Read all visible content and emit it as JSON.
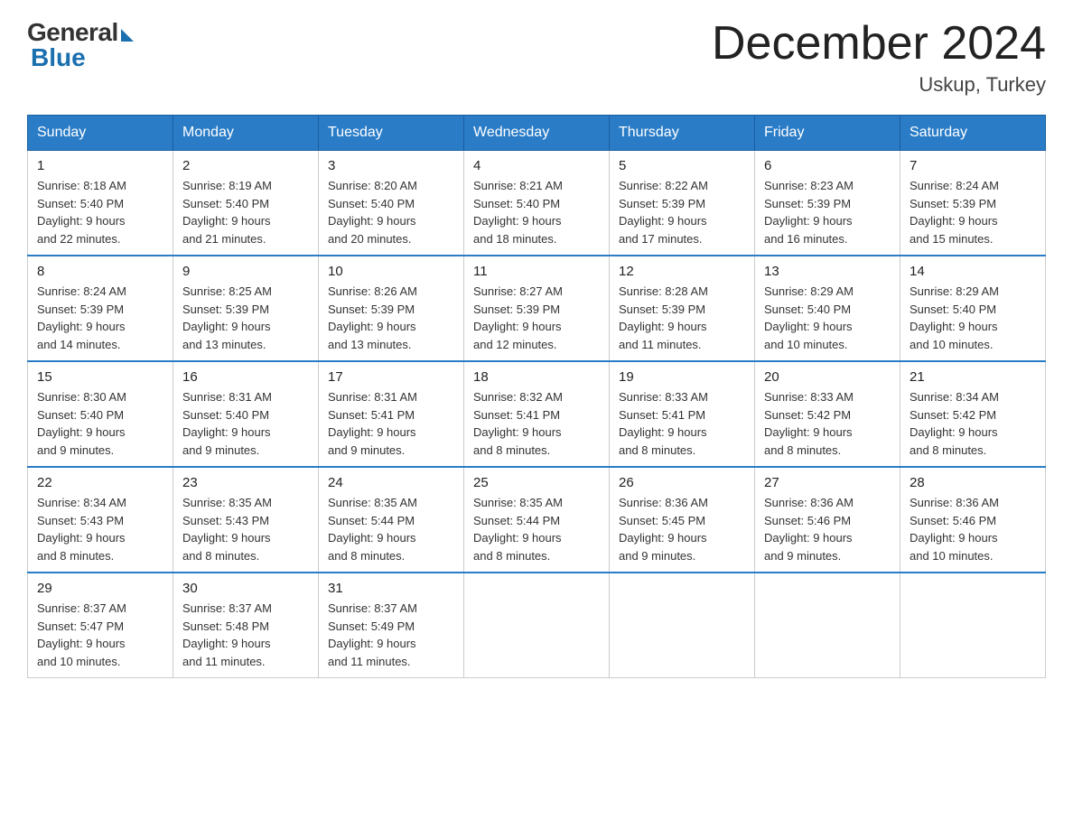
{
  "header": {
    "logo_general": "General",
    "logo_blue": "Blue",
    "month_year": "December 2024",
    "location": "Uskup, Turkey"
  },
  "days_of_week": [
    "Sunday",
    "Monday",
    "Tuesday",
    "Wednesday",
    "Thursday",
    "Friday",
    "Saturday"
  ],
  "weeks": [
    [
      {
        "day": "1",
        "sunrise": "8:18 AM",
        "sunset": "5:40 PM",
        "daylight": "9 hours and 22 minutes."
      },
      {
        "day": "2",
        "sunrise": "8:19 AM",
        "sunset": "5:40 PM",
        "daylight": "9 hours and 21 minutes."
      },
      {
        "day": "3",
        "sunrise": "8:20 AM",
        "sunset": "5:40 PM",
        "daylight": "9 hours and 20 minutes."
      },
      {
        "day": "4",
        "sunrise": "8:21 AM",
        "sunset": "5:40 PM",
        "daylight": "9 hours and 18 minutes."
      },
      {
        "day": "5",
        "sunrise": "8:22 AM",
        "sunset": "5:39 PM",
        "daylight": "9 hours and 17 minutes."
      },
      {
        "day": "6",
        "sunrise": "8:23 AM",
        "sunset": "5:39 PM",
        "daylight": "9 hours and 16 minutes."
      },
      {
        "day": "7",
        "sunrise": "8:24 AM",
        "sunset": "5:39 PM",
        "daylight": "9 hours and 15 minutes."
      }
    ],
    [
      {
        "day": "8",
        "sunrise": "8:24 AM",
        "sunset": "5:39 PM",
        "daylight": "9 hours and 14 minutes."
      },
      {
        "day": "9",
        "sunrise": "8:25 AM",
        "sunset": "5:39 PM",
        "daylight": "9 hours and 13 minutes."
      },
      {
        "day": "10",
        "sunrise": "8:26 AM",
        "sunset": "5:39 PM",
        "daylight": "9 hours and 13 minutes."
      },
      {
        "day": "11",
        "sunrise": "8:27 AM",
        "sunset": "5:39 PM",
        "daylight": "9 hours and 12 minutes."
      },
      {
        "day": "12",
        "sunrise": "8:28 AM",
        "sunset": "5:39 PM",
        "daylight": "9 hours and 11 minutes."
      },
      {
        "day": "13",
        "sunrise": "8:29 AM",
        "sunset": "5:40 PM",
        "daylight": "9 hours and 10 minutes."
      },
      {
        "day": "14",
        "sunrise": "8:29 AM",
        "sunset": "5:40 PM",
        "daylight": "9 hours and 10 minutes."
      }
    ],
    [
      {
        "day": "15",
        "sunrise": "8:30 AM",
        "sunset": "5:40 PM",
        "daylight": "9 hours and 9 minutes."
      },
      {
        "day": "16",
        "sunrise": "8:31 AM",
        "sunset": "5:40 PM",
        "daylight": "9 hours and 9 minutes."
      },
      {
        "day": "17",
        "sunrise": "8:31 AM",
        "sunset": "5:41 PM",
        "daylight": "9 hours and 9 minutes."
      },
      {
        "day": "18",
        "sunrise": "8:32 AM",
        "sunset": "5:41 PM",
        "daylight": "9 hours and 8 minutes."
      },
      {
        "day": "19",
        "sunrise": "8:33 AM",
        "sunset": "5:41 PM",
        "daylight": "9 hours and 8 minutes."
      },
      {
        "day": "20",
        "sunrise": "8:33 AM",
        "sunset": "5:42 PM",
        "daylight": "9 hours and 8 minutes."
      },
      {
        "day": "21",
        "sunrise": "8:34 AM",
        "sunset": "5:42 PM",
        "daylight": "9 hours and 8 minutes."
      }
    ],
    [
      {
        "day": "22",
        "sunrise": "8:34 AM",
        "sunset": "5:43 PM",
        "daylight": "9 hours and 8 minutes."
      },
      {
        "day": "23",
        "sunrise": "8:35 AM",
        "sunset": "5:43 PM",
        "daylight": "9 hours and 8 minutes."
      },
      {
        "day": "24",
        "sunrise": "8:35 AM",
        "sunset": "5:44 PM",
        "daylight": "9 hours and 8 minutes."
      },
      {
        "day": "25",
        "sunrise": "8:35 AM",
        "sunset": "5:44 PM",
        "daylight": "9 hours and 8 minutes."
      },
      {
        "day": "26",
        "sunrise": "8:36 AM",
        "sunset": "5:45 PM",
        "daylight": "9 hours and 9 minutes."
      },
      {
        "day": "27",
        "sunrise": "8:36 AM",
        "sunset": "5:46 PM",
        "daylight": "9 hours and 9 minutes."
      },
      {
        "day": "28",
        "sunrise": "8:36 AM",
        "sunset": "5:46 PM",
        "daylight": "9 hours and 10 minutes."
      }
    ],
    [
      {
        "day": "29",
        "sunrise": "8:37 AM",
        "sunset": "5:47 PM",
        "daylight": "9 hours and 10 minutes."
      },
      {
        "day": "30",
        "sunrise": "8:37 AM",
        "sunset": "5:48 PM",
        "daylight": "9 hours and 11 minutes."
      },
      {
        "day": "31",
        "sunrise": "8:37 AM",
        "sunset": "5:49 PM",
        "daylight": "9 hours and 11 minutes."
      },
      null,
      null,
      null,
      null
    ]
  ],
  "labels": {
    "sunrise": "Sunrise:",
    "sunset": "Sunset:",
    "daylight": "Daylight:"
  }
}
